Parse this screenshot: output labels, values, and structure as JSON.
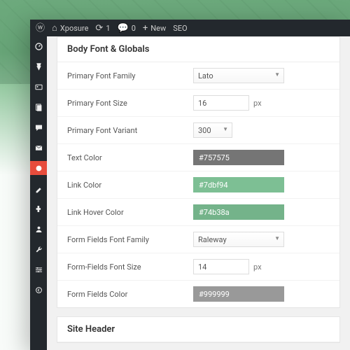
{
  "topbar": {
    "site_name": "Xposure",
    "updates_count": "1",
    "comments_count": "0",
    "new_label": "New",
    "seo_label": "SEO"
  },
  "section1_title": "Body Font & Globals",
  "section2_title": "Site Header",
  "rows": {
    "primary_font_family": {
      "label": "Primary Font Family",
      "value": "Lato"
    },
    "primary_font_size": {
      "label": "Primary Font Size",
      "value": "16",
      "unit": "px"
    },
    "primary_font_variant": {
      "label": "Primary Font Variant",
      "value": "300"
    },
    "text_color": {
      "label": "Text Color",
      "value": "#757575",
      "swatch": "#757575"
    },
    "link_color": {
      "label": "Link Color",
      "value": "#7dbf94",
      "swatch": "#7dbf94"
    },
    "link_hover_color": {
      "label": "Link Hover Color",
      "value": "#74b38a",
      "swatch": "#74b38a"
    },
    "form_fields_font_family": {
      "label": "Form Fields Font Family",
      "value": "Raleway"
    },
    "form_fields_font_size": {
      "label": "Form-Fields Font Size",
      "value": "14",
      "unit": "px"
    },
    "form_fields_color": {
      "label": "Form Fields Color",
      "value": "#999999",
      "swatch": "#999999"
    }
  }
}
